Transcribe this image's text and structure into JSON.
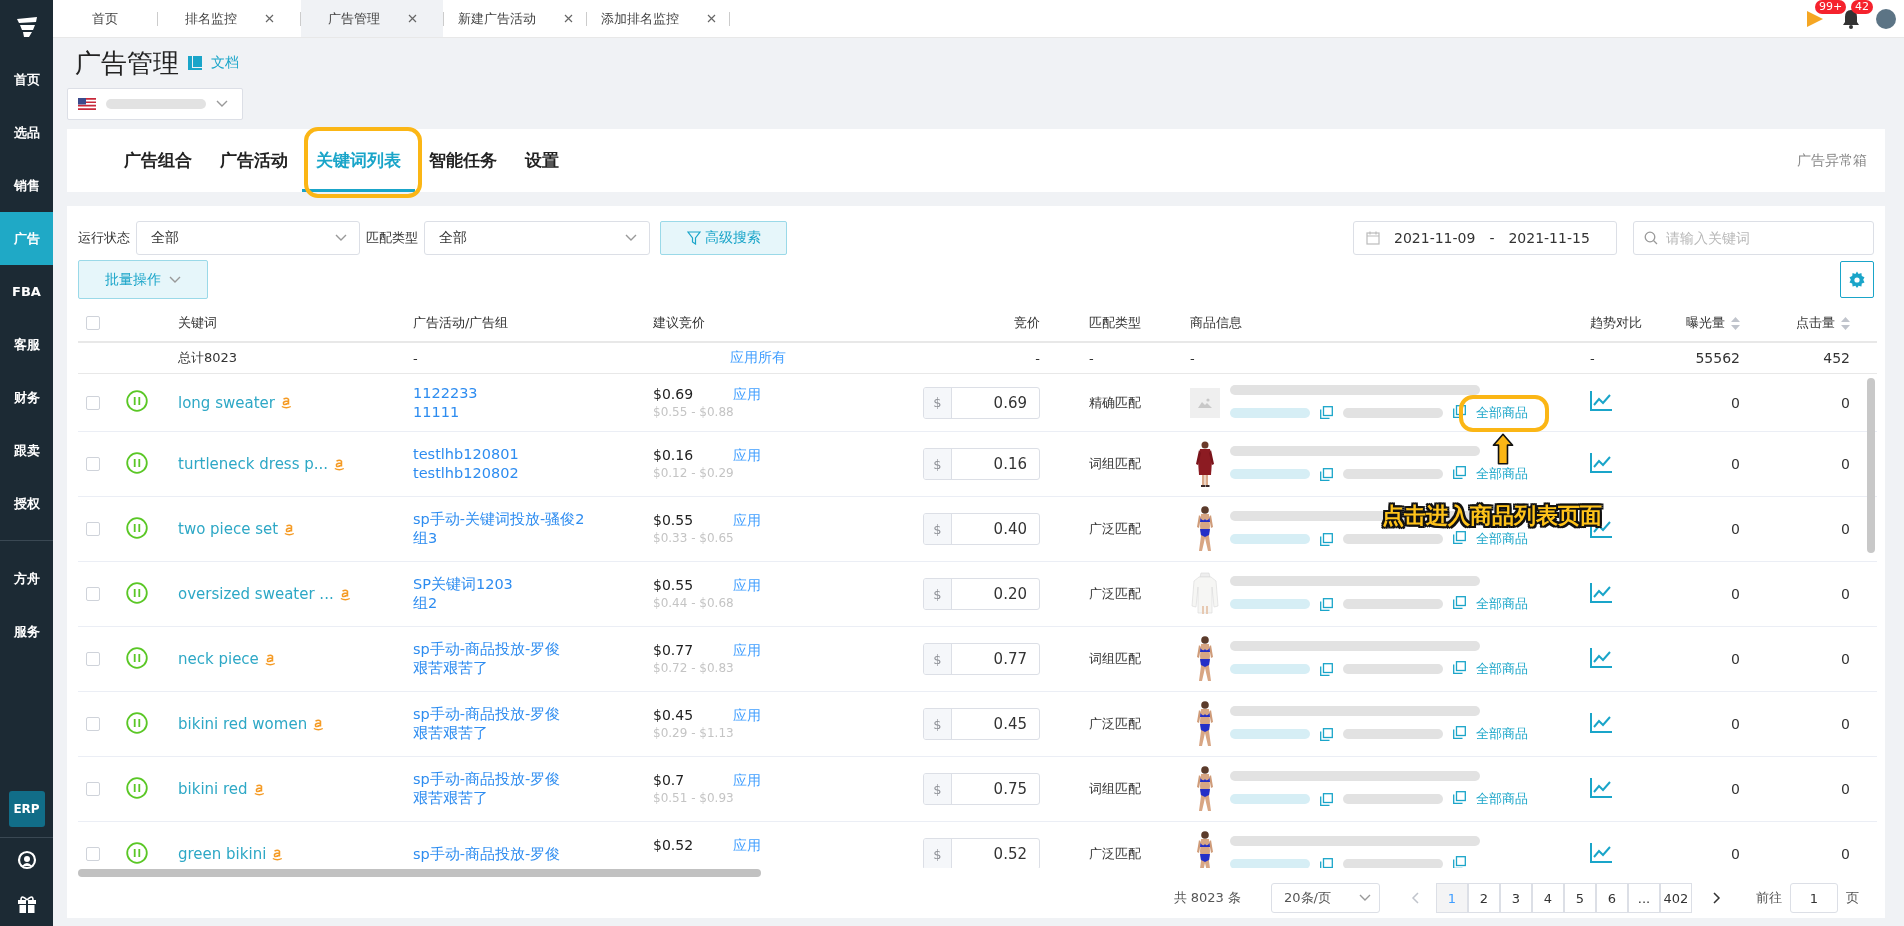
{
  "sidebar": {
    "items": [
      {
        "label": "首页",
        "selected": false
      },
      {
        "label": "选品",
        "selected": false
      },
      {
        "label": "销售",
        "selected": false
      },
      {
        "label": "广告",
        "selected": true
      },
      {
        "label": "FBA",
        "selected": false
      },
      {
        "label": "客服",
        "selected": false
      },
      {
        "label": "财务",
        "selected": false
      },
      {
        "label": "跟卖",
        "selected": false
      },
      {
        "label": "授权",
        "selected": false
      }
    ],
    "extra_items": [
      {
        "label": "方舟",
        "selected": false
      },
      {
        "label": "服务",
        "selected": false
      }
    ],
    "erp": "ERP"
  },
  "tabs_bar": {
    "tabs": [
      {
        "label": "首页",
        "closable": false,
        "selected": false
      },
      {
        "label": "排名监控",
        "closable": true,
        "selected": false
      },
      {
        "label": "广告管理",
        "closable": true,
        "selected": true
      },
      {
        "label": "新建广告活动",
        "closable": true,
        "selected": false
      },
      {
        "label": "添加排名监控",
        "closable": true,
        "selected": false
      }
    ],
    "flag_badge": "99+",
    "bell_badge": "42"
  },
  "page": {
    "title": "广告管理",
    "doc_link": "文档"
  },
  "section_tabs": [
    {
      "label": "广告组合",
      "selected": false
    },
    {
      "label": "广告活动",
      "selected": false
    },
    {
      "label": "关键词列表",
      "selected": true
    },
    {
      "label": "智能任务",
      "selected": false
    },
    {
      "label": "设置",
      "selected": false
    }
  ],
  "abnormal_box": "广告异常箱",
  "filters": {
    "status_label": "运行状态",
    "status_value": "全部",
    "match_label": "匹配类型",
    "match_value": "全部",
    "advanced_search": "高级搜索",
    "date_start": "2021-11-09",
    "date_separator": "-",
    "date_end": "2021-11-15",
    "search_placeholder": "请输入关键词",
    "batch": "批量操作"
  },
  "table": {
    "select_all_checked": false,
    "columns": [
      {
        "label": "关键词",
        "sortable": false
      },
      {
        "label": "广告活动/广告组",
        "sortable": false
      },
      {
        "label": "建议竞价",
        "sortable": false
      },
      {
        "label": "竞价",
        "sortable": false
      },
      {
        "label": "匹配类型",
        "sortable": false
      },
      {
        "label": "商品信息",
        "sortable": false
      },
      {
        "label": "趋势对比",
        "sortable": false
      },
      {
        "label": "曝光量",
        "sortable": true
      },
      {
        "label": "点击量",
        "sortable": true
      }
    ],
    "total": {
      "label": "总计8023",
      "campaign": "-",
      "apply_all": "应用所有",
      "bid": "-",
      "match": "-",
      "product": "-",
      "trend": "-",
      "impressions": "55562",
      "clicks": "452"
    },
    "rows": [
      {
        "checked": false,
        "paused": true,
        "keyword": "long sweater",
        "campaign": "1122233",
        "ad_group": "11111",
        "suggested": "$0.69",
        "range": "$0.55 - $0.88",
        "apply": "应用",
        "currency": "$",
        "bid": "0.69",
        "match": "精确匹配",
        "image": {
          "kind": "placeholder"
        },
        "all_products": "全部商品",
        "impressions": "0",
        "clicks": "0"
      },
      {
        "checked": false,
        "paused": true,
        "keyword": "turtleneck dress p...",
        "campaign": "testlhb120801",
        "ad_group": "testlhb120802",
        "suggested": "$0.16",
        "range": "$0.12 - $0.29",
        "apply": "应用",
        "currency": "$",
        "bid": "0.16",
        "match": "词组匹配",
        "image": {
          "kind": "dress"
        },
        "all_products": "全部商品",
        "impressions": "0",
        "clicks": "0"
      },
      {
        "checked": false,
        "paused": true,
        "keyword": "two piece set",
        "campaign": "sp手动-关键词投放-骚俊2",
        "ad_group": "组3",
        "suggested": "$0.55",
        "range": "$0.33 - $0.65",
        "apply": "应用",
        "currency": "$",
        "bid": "0.40",
        "match": "广泛匹配",
        "image": {
          "kind": "swimsuit"
        },
        "all_products": "全部商品",
        "impressions": "0",
        "clicks": "0"
      },
      {
        "checked": false,
        "paused": true,
        "keyword": "oversized sweater ...",
        "campaign": "SP关键词1203",
        "ad_group": "组2",
        "suggested": "$0.55",
        "range": "$0.44 - $0.68",
        "apply": "应用",
        "currency": "$",
        "bid": "0.20",
        "match": "广泛匹配",
        "image": {
          "kind": "sweater"
        },
        "all_products": "全部商品",
        "impressions": "0",
        "clicks": "0"
      },
      {
        "checked": false,
        "paused": true,
        "keyword": "neck piece",
        "campaign": "sp手动-商品投放-罗俊",
        "ad_group": "艰苦艰苦了",
        "suggested": "$0.77",
        "range": "$0.72 - $0.83",
        "apply": "应用",
        "currency": "$",
        "bid": "0.77",
        "match": "词组匹配",
        "image": {
          "kind": "swimsuit"
        },
        "all_products": "全部商品",
        "impressions": "0",
        "clicks": "0"
      },
      {
        "checked": false,
        "paused": true,
        "keyword": "bikini red women",
        "campaign": "sp手动-商品投放-罗俊",
        "ad_group": "艰苦艰苦了",
        "suggested": "$0.45",
        "range": "$0.29 - $1.13",
        "apply": "应用",
        "currency": "$",
        "bid": "0.45",
        "match": "广泛匹配",
        "image": {
          "kind": "swimsuit"
        },
        "all_products": "全部商品",
        "impressions": "0",
        "clicks": "0"
      },
      {
        "checked": false,
        "paused": true,
        "keyword": "bikini red",
        "campaign": "sp手动-商品投放-罗俊",
        "ad_group": "艰苦艰苦了",
        "suggested": "$0.7",
        "range": "$0.51 - $0.93",
        "apply": "应用",
        "currency": "$",
        "bid": "0.75",
        "match": "词组匹配",
        "image": {
          "kind": "swimsuit"
        },
        "all_products": "全部商品",
        "impressions": "0",
        "clicks": "0"
      },
      {
        "checked": false,
        "paused": true,
        "keyword": "green bikini",
        "campaign": "sp手动-商品投放-罗俊",
        "suggested": "$0.52",
        "apply": "应用",
        "currency": "$",
        "bid": "0.52",
        "match": "广泛匹配",
        "image": {
          "kind": "swimsuit"
        },
        "impressions": "0",
        "clicks": "0"
      }
    ]
  },
  "pagination": {
    "total": "共 8023 条",
    "page_size": "20条/页",
    "pages": [
      {
        "label": "1",
        "selected": true
      },
      {
        "label": "2",
        "selected": false
      },
      {
        "label": "3",
        "selected": false
      },
      {
        "label": "4",
        "selected": false
      },
      {
        "label": "5",
        "selected": false
      },
      {
        "label": "6",
        "selected": false
      },
      {
        "label": "...",
        "selected": false
      },
      {
        "label": "402",
        "selected": false
      }
    ],
    "goto_label": "前往",
    "goto_value": "1",
    "page_unit": "页"
  },
  "annotation": {
    "callout": "点击进入商品列表页面"
  }
}
